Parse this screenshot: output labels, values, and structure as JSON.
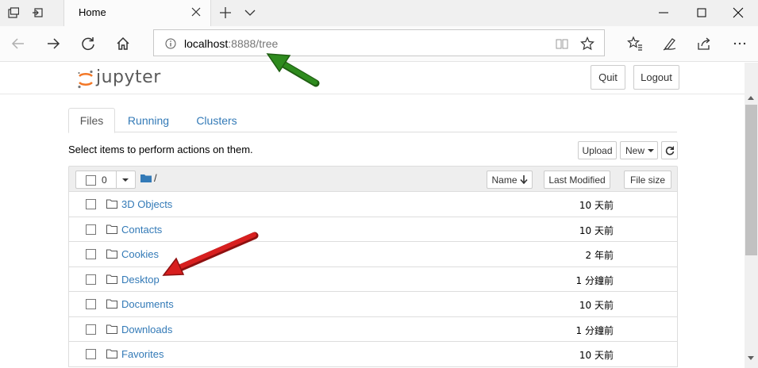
{
  "browser": {
    "tab_title": "Home",
    "address_host": "localhost",
    "address_rest": ":8888/tree"
  },
  "header": {
    "logo_text": "jupyter",
    "quit_label": "Quit",
    "logout_label": "Logout"
  },
  "tabs": [
    {
      "label": "Files"
    },
    {
      "label": "Running"
    },
    {
      "label": "Clusters"
    }
  ],
  "toolbar": {
    "hint": "Select items to perform actions on them.",
    "upload_label": "Upload",
    "new_label": "New",
    "selected_count": "0",
    "breadcrumb": "/"
  },
  "columns": {
    "name": "Name",
    "last_modified": "Last Modified",
    "file_size": "File size"
  },
  "files": [
    {
      "name": "3D Objects",
      "modified": "10 天前"
    },
    {
      "name": "Contacts",
      "modified": "10 天前"
    },
    {
      "name": "Cookies",
      "modified": "2 年前"
    },
    {
      "name": "Desktop",
      "modified": "1 分鐘前"
    },
    {
      "name": "Documents",
      "modified": "10 天前"
    },
    {
      "name": "Downloads",
      "modified": "1 分鐘前"
    },
    {
      "name": "Favorites",
      "modified": "10 天前"
    }
  ],
  "colors": {
    "link": "#337ab7",
    "annotation_green": "#2e8b1e",
    "annotation_red": "#d81f1f",
    "logo_orange": "#f37726"
  }
}
